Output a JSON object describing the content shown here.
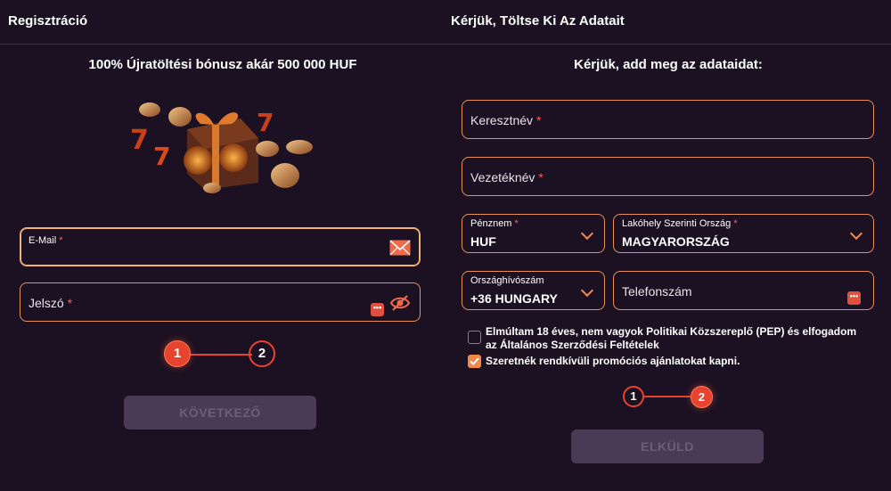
{
  "left": {
    "title": "Regisztráció",
    "bonus_heading": "100% Újratöltési bónusz akár 500 000 HUF",
    "email": {
      "label": "E-Mail",
      "required": "*"
    },
    "password": {
      "label": "Jelszó",
      "required": "*"
    },
    "steps": [
      "1",
      "2"
    ],
    "next_button": "KÖVETKEZŐ"
  },
  "right": {
    "title": "Kérjük, Töltse Ki Az Adatait",
    "heading": "Kérjük, add meg az adataidat:",
    "first_name": {
      "label": "Keresztnév",
      "required": "*"
    },
    "last_name": {
      "label": "Vezetéknév",
      "required": "*"
    },
    "currency": {
      "label": "Pénznem",
      "required": "*",
      "value": "HUF"
    },
    "country": {
      "label": "Lakóhely Szerinti Ország",
      "required": "*",
      "value": "MAGYARORSZÁG"
    },
    "dial_code": {
      "label": "Országhívószám",
      "value": "+36 HUNGARY"
    },
    "phone": {
      "label": "Telefonszám"
    },
    "terms": {
      "text": "Elmúltam 18 éves, nem vagyok Politikai Közszereplő (PEP) és elfogadom az Általános Szerződési Feltételek",
      "checked": false
    },
    "promo": {
      "text": "Szeretnék rendkívüli promóciós ajánlatokat kapni.",
      "checked": true
    },
    "steps": [
      "1",
      "2"
    ],
    "submit_button": "ELKÜLD"
  },
  "colors": {
    "accent": "#e8432f",
    "border": "#e8925a",
    "background": "#1c1122",
    "disabled_button": "#4a3a55"
  },
  "icons": {
    "email": "envelope-icon",
    "password_toggle": "eye-off-icon",
    "dots": "more-dots-icon",
    "dropdown": "chevron-down-icon"
  }
}
